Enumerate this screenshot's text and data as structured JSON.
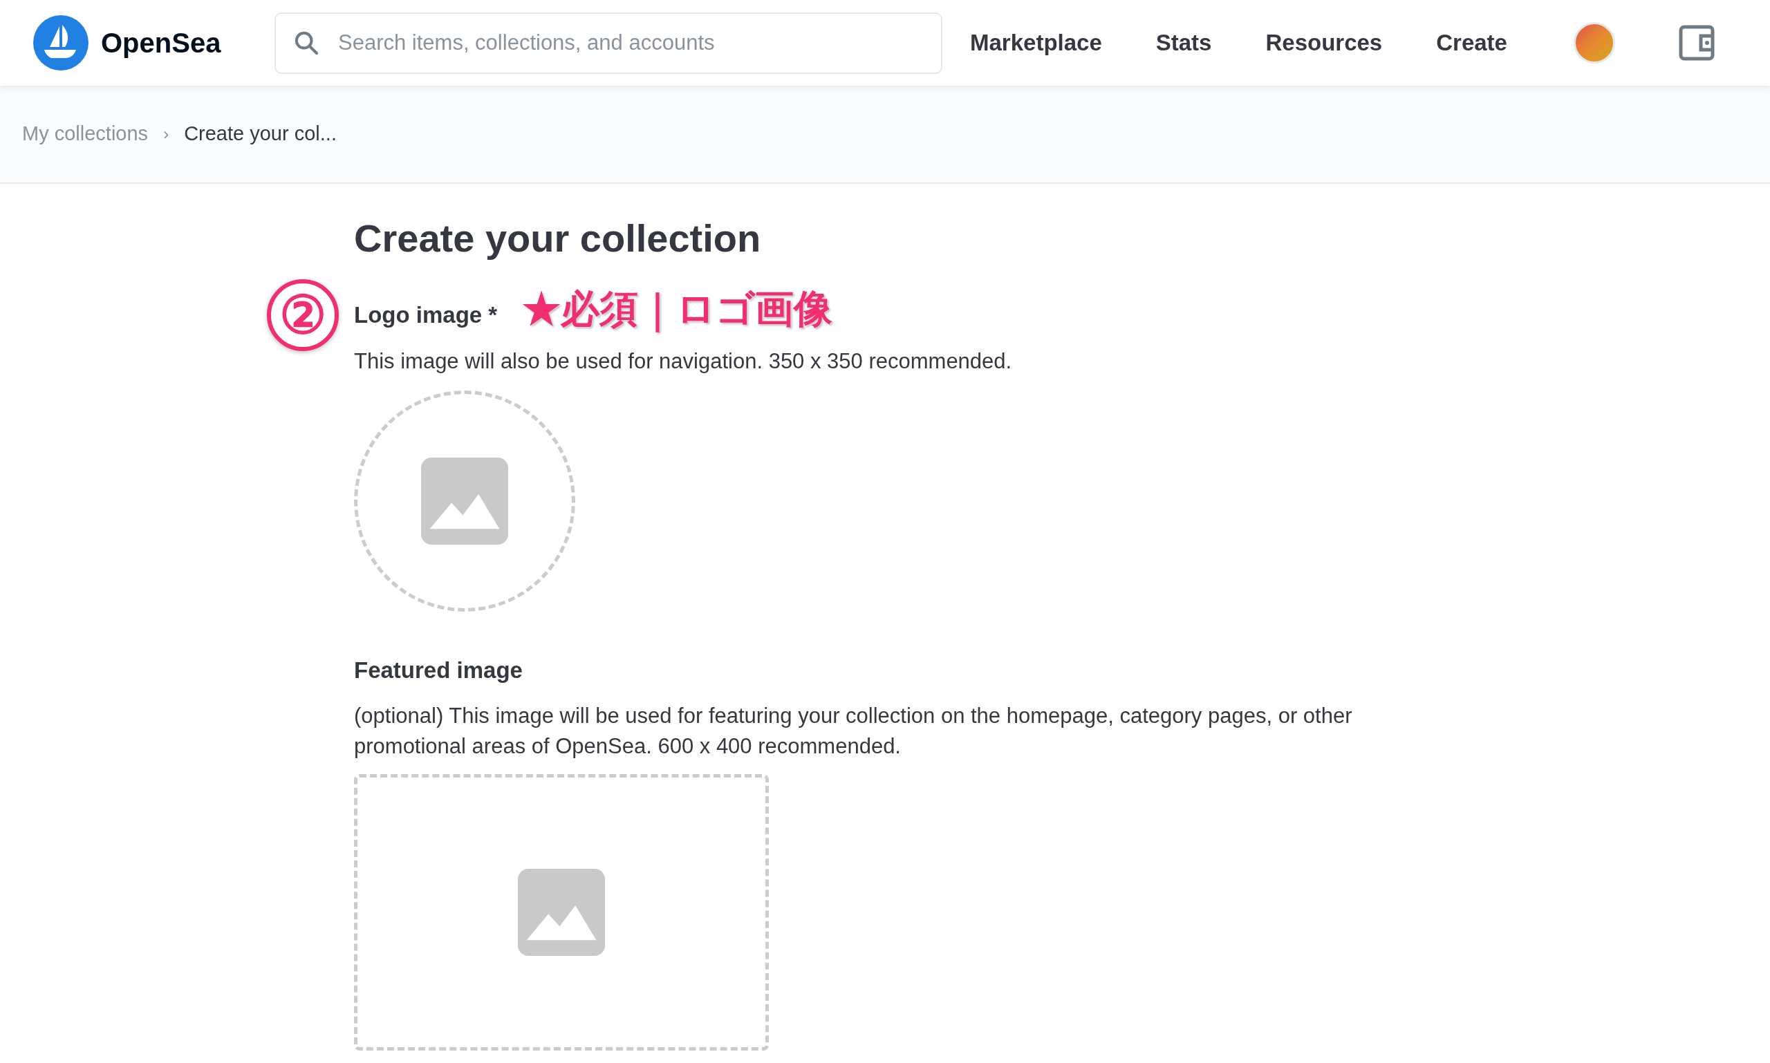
{
  "header": {
    "brand": "OpenSea",
    "search": {
      "placeholder": "Search items, collections, and accounts"
    },
    "nav": [
      "Marketplace",
      "Stats",
      "Resources",
      "Create"
    ]
  },
  "breadcrumb_separator": "›",
  "breadcrumb": [
    {
      "label": "My collections",
      "current": false
    },
    {
      "label": "Create your col...",
      "current": true
    }
  ],
  "page": {
    "title": "Create your collection"
  },
  "logo_field": {
    "marker": "②",
    "label": "Logo image *",
    "annotation": "★必須｜ロゴ画像",
    "description": "This image will also be used for navigation. 350 x 350 recommended."
  },
  "featured_field": {
    "label": "Featured image",
    "description": "(optional) This image will be used for featuring your collection on the homepage, category pages, or other promotional areas of OpenSea. 600 x 400 recommended."
  }
}
